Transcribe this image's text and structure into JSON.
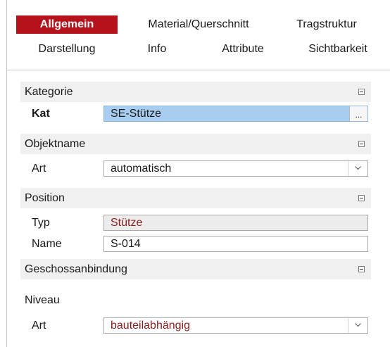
{
  "tabs": {
    "row1": [
      "Allgemein",
      "Material/Querschnitt",
      "Tragstruktur"
    ],
    "row2": [
      "Darstellung",
      "Info",
      "Attribute",
      "Sichtbarkeit"
    ],
    "active": "Allgemein"
  },
  "sections": {
    "kategorie": {
      "title": "Kategorie",
      "kat_label": "Kat",
      "kat_value": "SE-Stütze",
      "kat_button": "..."
    },
    "objektname": {
      "title": "Objektname",
      "art_label": "Art",
      "art_value": "automatisch"
    },
    "position": {
      "title": "Position",
      "typ_label": "Typ",
      "typ_value": "Stütze",
      "name_label": "Name",
      "name_value": "S-014"
    },
    "geschossanbindung": {
      "title": "Geschossanbindung",
      "niveau_label": "Niveau",
      "art_label": "Art",
      "art_value": "bauteilabhängig"
    }
  },
  "colors": {
    "accent": "#b5121b",
    "highlight": "#a9cdf0",
    "red_text": "#8a1c1c",
    "category_bg": "#f0f0f0"
  },
  "icons": {
    "collapse": "minus-box-icon",
    "dropdown": "chevron-down-icon",
    "browse": "ellipsis-icon"
  }
}
